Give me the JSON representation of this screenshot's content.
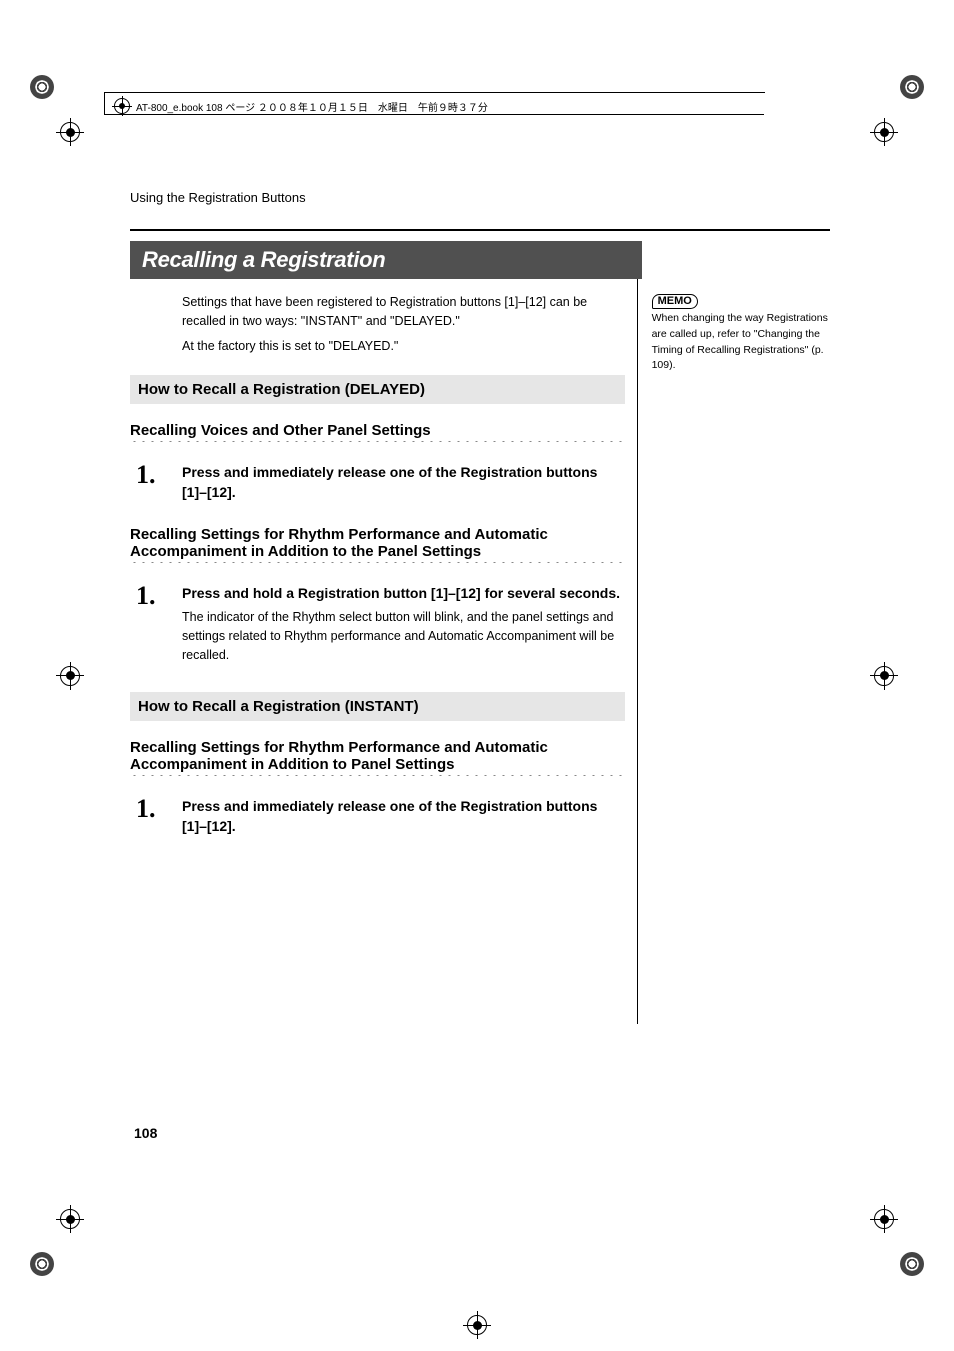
{
  "header_book_info": "AT-800_e.book  108 ページ  ２００８年１０月１５日　水曜日　午前９時３７分",
  "running_head": "Using the Registration Buttons",
  "section_title": "Recalling a Registration",
  "intro_p1": "Settings that have been registered to Registration buttons [1]–[12] can be recalled in two ways: \"INSTANT\" and \"DELAYED.\"",
  "intro_p2": "At the factory this is set to \"DELAYED.\"",
  "subsection_delayed": "How to Recall a Registration (DELAYED)",
  "voices_heading": "Recalling Voices and Other Panel Settings",
  "step_delayed_voices_num": "1.",
  "step_delayed_voices_title": "Press and immediately release one of the Registration buttons [1]–[12].",
  "rhythm_heading_1": "Recalling Settings for Rhythm Performance and Automatic Accompaniment in Addition to the Panel Settings",
  "step_delayed_rhythm_num": "1.",
  "step_delayed_rhythm_title": "Press and hold a Registration button [1]–[12] for several seconds.",
  "step_delayed_rhythm_text": "The indicator of the Rhythm select button will blink, and the panel settings and settings related to Rhythm performance and Automatic Accompaniment will be recalled.",
  "subsection_instant": "How to Recall a Registration (INSTANT)",
  "rhythm_heading_2": "Recalling Settings for Rhythm Performance and Automatic Accompaniment in Addition to Panel Settings",
  "step_instant_num": "1.",
  "step_instant_title": "Press and immediately release one of the Registration buttons [1]–[12].",
  "memo_label": "MEMO",
  "memo_text": "When changing the way Registrations are called up, refer to \"Changing the Timing of Recalling Registrations\" (p. 109).",
  "page_number": "108"
}
